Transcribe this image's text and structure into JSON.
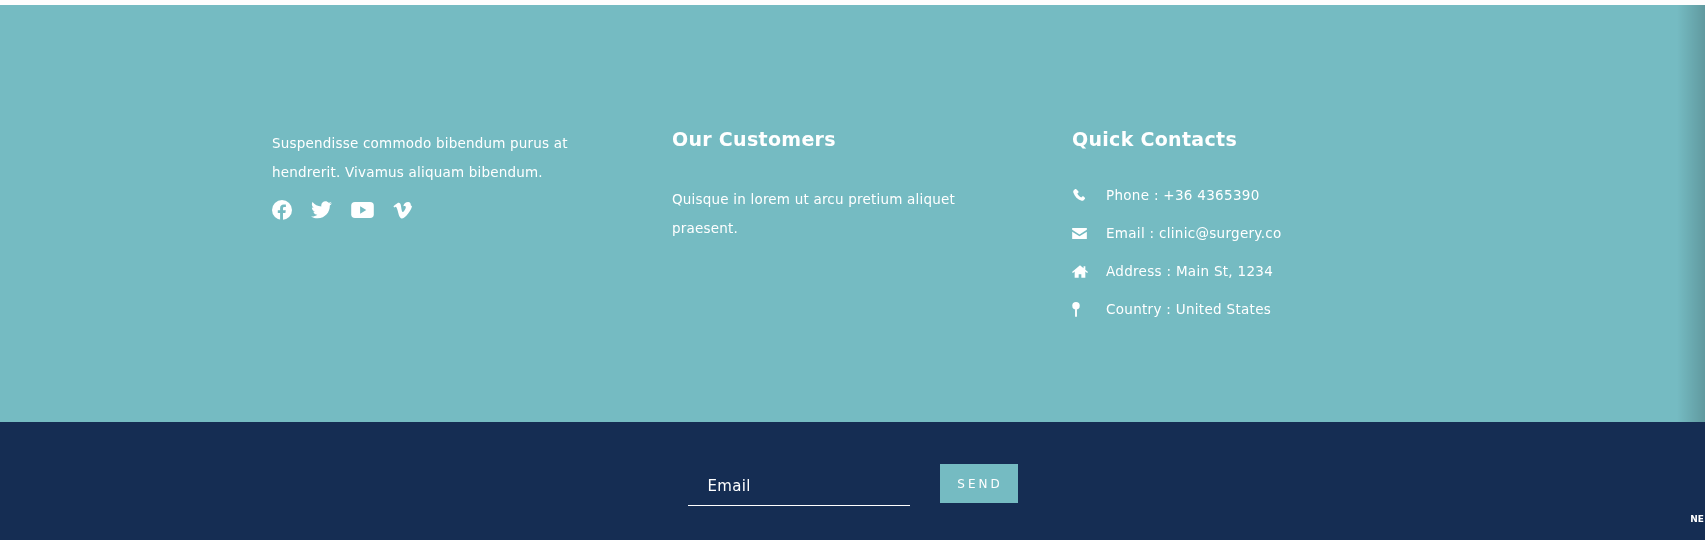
{
  "about": {
    "text": "Suspendisse commodo bibendum purus at hendrerit. Vivamus aliquam bibendum.",
    "social": [
      {
        "kind": "facebook"
      },
      {
        "kind": "twitter"
      },
      {
        "kind": "youtube"
      },
      {
        "kind": "vimeo"
      }
    ]
  },
  "customers": {
    "title": "Our Customers",
    "text": "Quisque in lorem ut arcu pretium aliquet praesent."
  },
  "contacts": {
    "title": "Quick Contacts",
    "items": [
      {
        "kind": "phone",
        "text": "Phone : +36 4365390"
      },
      {
        "kind": "email",
        "text": "Email : clinic@surgery.co"
      },
      {
        "kind": "address",
        "text": "Address : Main St, 1234"
      },
      {
        "kind": "country",
        "text": "Country : United States"
      }
    ]
  },
  "newsletter": {
    "placeholder": "Email",
    "button": "SEND"
  },
  "corner_text": "NE"
}
